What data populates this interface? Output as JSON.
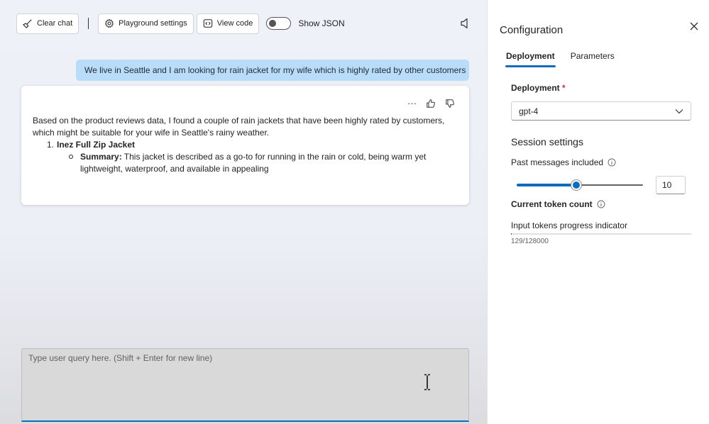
{
  "toolbar": {
    "clear_chat_label": "Clear chat",
    "playground_settings_label": "Playground settings",
    "view_code_label": "View code",
    "show_json_label": "Show JSON",
    "show_json_on": false
  },
  "chat": {
    "user_message": "We live in Seattle and I am looking for rain jacket for my wife which is highly rated by other customers",
    "assistant": {
      "more_label": "···",
      "intro": "Based on the product reviews data, I found a couple of rain jackets that have been highly rated by customers, which might be suitable for your wife in Seattle's rainy weather.",
      "items": [
        {
          "number": "1.",
          "name": "Inez Full Zip Jacket",
          "summary_label": "Summary:",
          "summary_text": " This jacket is described as a go-to for running in the rain or cold, being warm yet lightweight, waterproof, and available in appealing"
        }
      ]
    },
    "query_placeholder": "Type user query here. (Shift + Enter for new line)",
    "accent_color": "#b9dcf8"
  },
  "config": {
    "title": "Configuration",
    "tabs": [
      {
        "label": "Deployment",
        "active": true
      },
      {
        "label": "Parameters",
        "active": false
      }
    ],
    "deployment_label": "Deployment",
    "required_marker": "*",
    "deployment_value": "gpt-4",
    "session_settings_title": "Session settings",
    "past_messages_label": "Past messages included",
    "past_messages_value": "10",
    "past_messages_fraction": 0.47,
    "token_count_label": "Current token count",
    "progress_label": "Input tokens progress indicator",
    "progress_text": "129/128000",
    "progress_fraction": 0.001,
    "accent_color": "#0f6cbd"
  }
}
